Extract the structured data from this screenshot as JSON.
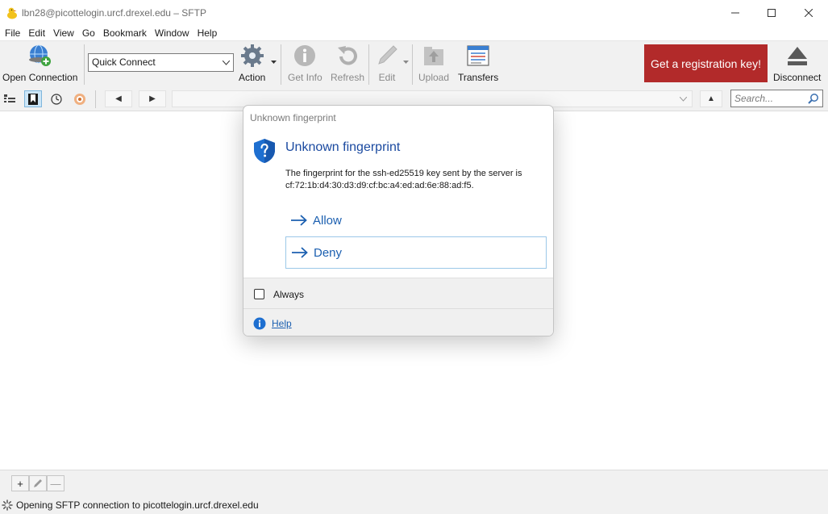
{
  "window": {
    "title": "lbn28@picottelogin.urcf.drexel.edu – SFTP",
    "app_icon": "duck-icon",
    "controls": {
      "minimize": "—",
      "maximize": "☐",
      "close": "✕"
    }
  },
  "menubar": {
    "items": [
      "File",
      "Edit",
      "View",
      "Go",
      "Bookmark",
      "Window",
      "Help"
    ]
  },
  "toolbar": {
    "open_connection": {
      "label": "Open Connection",
      "icon": "globe-plus-icon"
    },
    "quick_connect": {
      "value": "Quick Connect"
    },
    "action": {
      "label": "Action",
      "icon": "gear-icon"
    },
    "get_info": {
      "label": "Get Info",
      "icon": "info-icon"
    },
    "refresh": {
      "label": "Refresh",
      "icon": "refresh-icon"
    },
    "edit": {
      "label": "Edit",
      "icon": "pencil-icon"
    },
    "upload": {
      "label": "Upload",
      "icon": "upload-icon"
    },
    "transfers": {
      "label": "Transfers",
      "icon": "transfers-icon"
    },
    "registration": {
      "label": "Get a registration key!",
      "color": "#b22a2a"
    },
    "disconnect": {
      "label": "Disconnect",
      "icon": "eject-icon"
    }
  },
  "navbar": {
    "back_glyph": "◀",
    "forward_glyph": "▶",
    "up_glyph": "▲",
    "search_placeholder": "Search..."
  },
  "dialog": {
    "caption": "Unknown fingerprint",
    "heading": "Unknown fingerprint",
    "body": "The fingerprint for the ssh-ed25519 key sent by the server is cf:72:1b:d4:30:d3:d9:cf:bc:a4:ed:ad:6e:88:ad:f5.",
    "allow_label": "Allow",
    "deny_label": "Deny",
    "always_label": "Always",
    "always_checked": false,
    "help_label": "Help"
  },
  "bottombar": {
    "add_glyph": "+",
    "remove_glyph": "—"
  },
  "status": {
    "text": "Opening SFTP connection to picottelogin.urcf.drexel.edu"
  },
  "colors": {
    "accent": "#1b5fb0",
    "heading": "#1b4aa0",
    "banner": "#b22a2a"
  }
}
